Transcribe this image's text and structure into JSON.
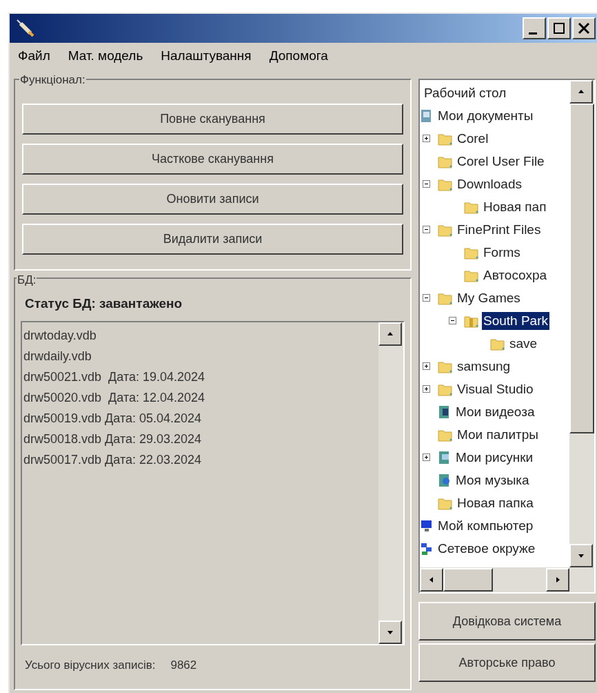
{
  "menu": [
    "Файл",
    "Мат. модель",
    "Налаштування",
    "Допомога"
  ],
  "functions": {
    "legend": "Функціонал:",
    "buttons": [
      "Повне сканування",
      "Часткове сканування",
      "Оновити записи",
      "Видалити записи"
    ]
  },
  "database": {
    "legend": "БД:",
    "status": "Статус БД: завантажено",
    "files": [
      "drwtoday.vdb",
      "drwdaily.vdb",
      "drw50021.vdb  Дата: 19.04.2024",
      "drw50020.vdb  Дата: 12.04.2024",
      "drw50019.vdb Дата: 05.04.2024",
      "drw50018.vdb Дата: 29.03.2024",
      "drw50017.vdb Дата: 22.03.2024"
    ],
    "total_label": "Усього вірусних записів:",
    "total_value": "9862"
  },
  "tree": [
    {
      "label": "Рабочий стол",
      "selected": false,
      "children": [
        {
          "label": "Мои документы",
          "kind": "documents",
          "selected": false,
          "children": [
            {
              "label": "Corel",
              "kind": "folder",
              "selected": false,
              "expanded": false
            },
            {
              "label": "Corel User File",
              "kind": "folder",
              "selected": false
            },
            {
              "label": "Downloads",
              "kind": "folder",
              "selected": false,
              "expanded": true,
              "children": [
                {
                  "label": "Новая пап",
                  "kind": "folder",
                  "selected": false
                }
              ]
            },
            {
              "label": "FinePrint Files",
              "kind": "folder",
              "selected": false,
              "expanded": true,
              "children": [
                {
                  "label": "Forms",
                  "kind": "folder",
                  "selected": false
                },
                {
                  "label": "Автосохра",
                  "kind": "folder",
                  "selected": false
                }
              ]
            },
            {
              "label": "My Games",
              "kind": "folder",
              "selected": false,
              "expanded": true,
              "children": [
                {
                  "label": "South Park",
                  "kind": "open-folder",
                  "selected": true,
                  "expanded": true,
                  "children": [
                    {
                      "label": "save",
                      "kind": "folder",
                      "selected": false
                    }
                  ]
                }
              ]
            },
            {
              "label": "samsung",
              "kind": "folder",
              "selected": false,
              "expanded": false
            },
            {
              "label": "Visual Studio",
              "kind": "folder",
              "selected": false,
              "expanded": false
            },
            {
              "label": "Мои видеоза",
              "kind": "video",
              "selected": false
            },
            {
              "label": "Мои палитры",
              "kind": "folder",
              "selected": false
            },
            {
              "label": "Мои рисунки",
              "kind": "pictures",
              "selected": false,
              "expanded": false
            },
            {
              "label": "Моя музыка",
              "kind": "music",
              "selected": false
            },
            {
              "label": "Новая папка",
              "kind": "folder",
              "selected": false
            }
          ]
        },
        {
          "label": "Мой компьютер",
          "kind": "computer",
          "selected": false
        },
        {
          "label": "Сетевое окруже",
          "kind": "network",
          "selected": false
        }
      ]
    }
  ],
  "side_buttons": [
    "Довідкова система",
    "Авторське право"
  ]
}
